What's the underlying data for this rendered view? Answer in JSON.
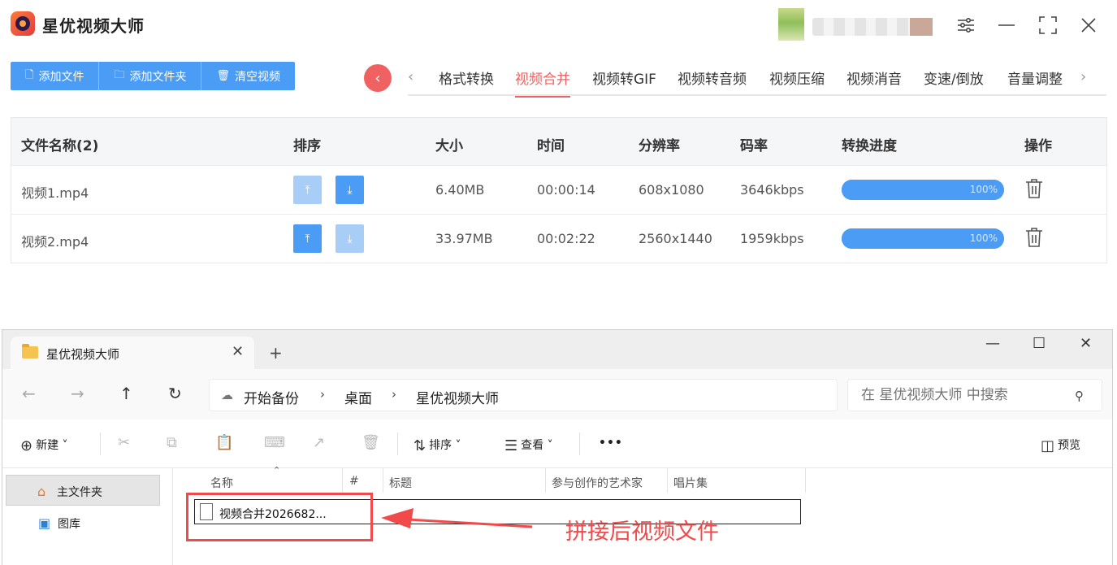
{
  "app": {
    "title": "星优视频大师",
    "colors": {
      "accent": "#4b9cf5",
      "active_tab": "#f06262"
    },
    "window_controls": [
      "sliders-icon",
      "minimize-icon",
      "maximize-icon",
      "close-icon"
    ]
  },
  "toolbar": {
    "add_file": "添加文件",
    "add_folder": "添加文件夹",
    "clear": "清空视频"
  },
  "tabs": [
    "格式转换",
    "视频合并",
    "视频转GIF",
    "视频转音频",
    "视频压缩",
    "视频消音",
    "变速/倒放",
    "音量调整"
  ],
  "active_tab": "视频合并",
  "table": {
    "headers": [
      "文件名称(2)",
      "排序",
      "大小",
      "时间",
      "分辨率",
      "码率",
      "转换进度",
      "操作"
    ],
    "rows": [
      {
        "name": "视频1.mp4",
        "size": "6.40MB",
        "time": "00:00:14",
        "resolution": "608x1080",
        "bitrate": "3646kbps",
        "progress": 100,
        "progress_text": "100%",
        "up_disabled": true,
        "down_disabled": false
      },
      {
        "name": "视频2.mp4",
        "size": "33.97MB",
        "time": "00:02:22",
        "resolution": "2560x1440",
        "bitrate": "1959kbps",
        "progress": 100,
        "progress_text": "100%",
        "up_disabled": false,
        "down_disabled": true
      }
    ]
  },
  "explorer": {
    "tab_title": "星优视频大师",
    "address": {
      "home": "开始备份",
      "crumbs": [
        "桌面",
        "星优视频大师"
      ]
    },
    "search_placeholder": "在 星优视频大师 中搜索",
    "commands": {
      "new": "新建",
      "sort": "排序",
      "view": "查看",
      "more": "•••",
      "preview": "预览"
    },
    "sidebar": [
      "主文件夹",
      "图库"
    ],
    "columns": [
      "名称",
      "#",
      "标题",
      "参与创作的艺术家",
      "唱片集"
    ],
    "file": "视频合并2026682..."
  },
  "annotation": {
    "text": "拼接后视频文件",
    "color": "#f04a4a"
  }
}
